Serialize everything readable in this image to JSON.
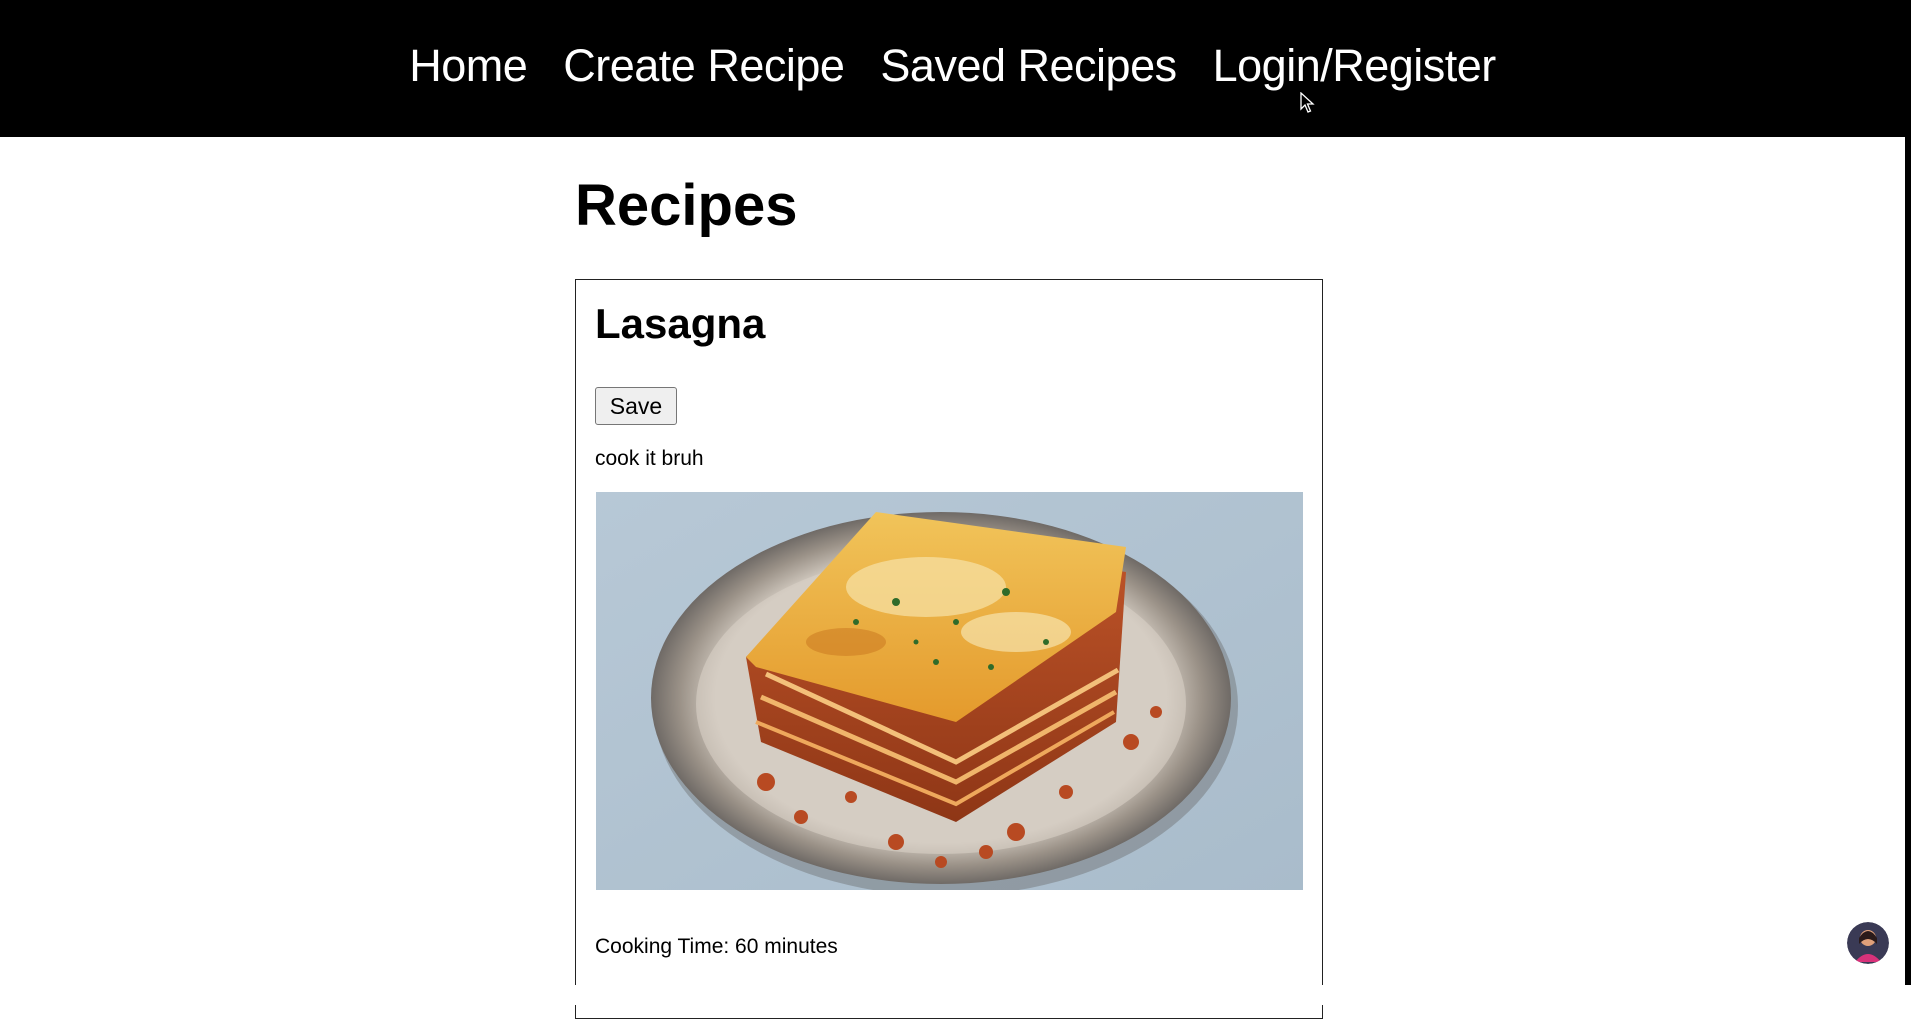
{
  "nav": {
    "items": [
      {
        "label": "Home"
      },
      {
        "label": "Create Recipe"
      },
      {
        "label": "Saved Recipes"
      },
      {
        "label": "Login/Register"
      }
    ]
  },
  "main": {
    "title": "Recipes",
    "recipes": [
      {
        "name": "Lasagna",
        "save_label": "Save",
        "instructions": "cook it bruh",
        "image_icon": "lasagna-photo",
        "cooking_time": "Cooking Time: 60 minutes"
      }
    ]
  },
  "colors": {
    "navbar_bg": "#000000",
    "nav_text": "#ffffff",
    "page_bg": "#ffffff",
    "card_border": "#222222"
  }
}
